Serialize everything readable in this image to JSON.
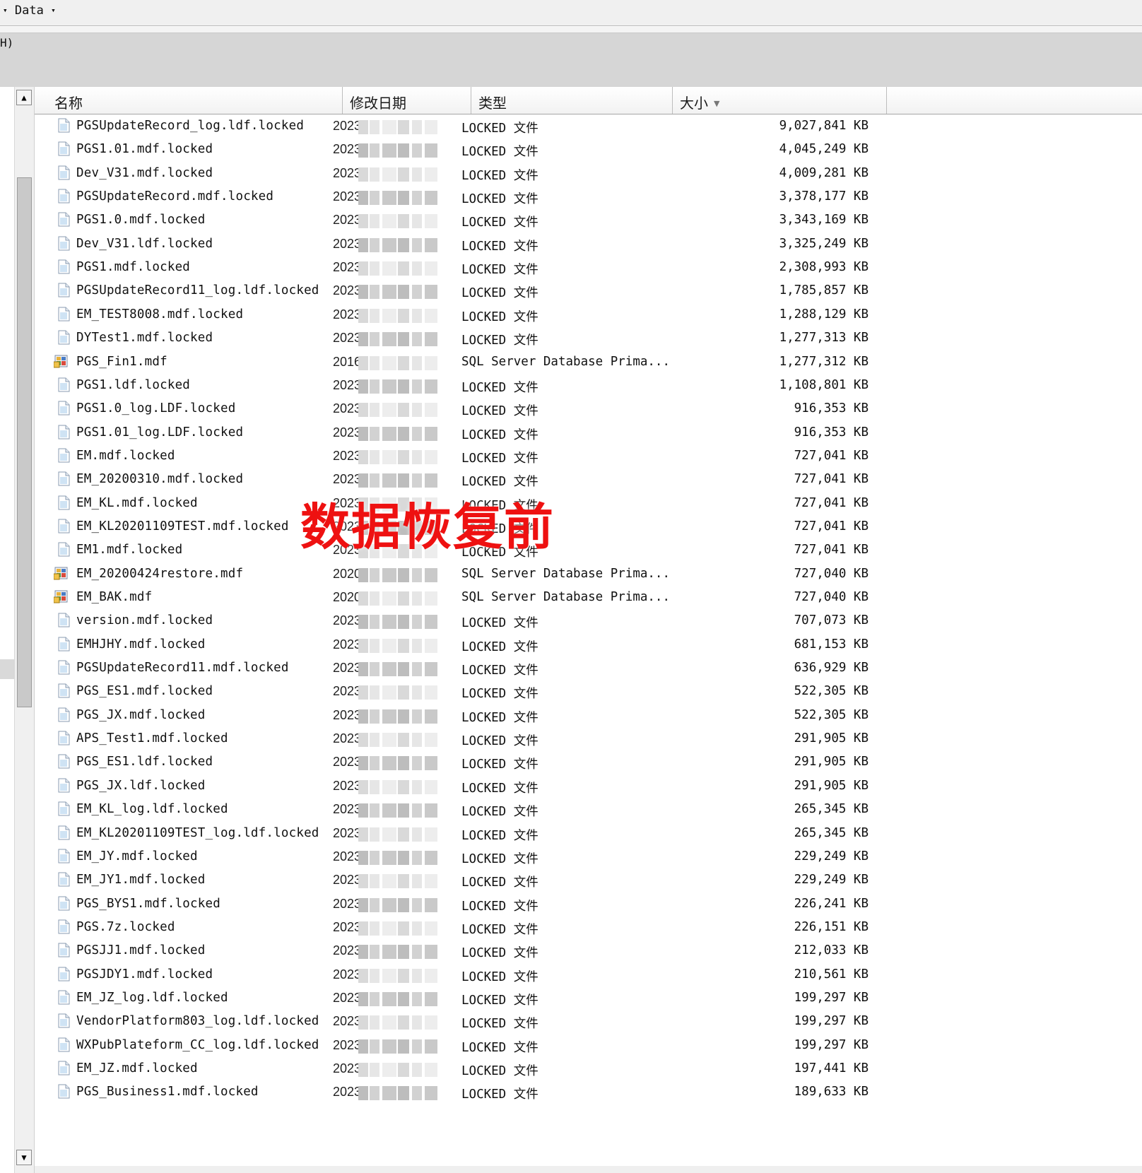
{
  "breadcrumb": {
    "label": "Data"
  },
  "toolbar": {
    "hotkey_fragment": "H)"
  },
  "columns": {
    "name": "名称",
    "date": "修改日期",
    "type": "类型",
    "size": "大小"
  },
  "watermark": "数据恢复前",
  "files": [
    {
      "name": "PGSUpdateRecord_log.ldf.locked",
      "date": "2023",
      "type": "LOCKED 文件",
      "size": "9,027,841 KB",
      "icon": "file-icon"
    },
    {
      "name": "PGS1.01.mdf.locked",
      "date": "2023",
      "type": "LOCKED 文件",
      "size": "4,045,249 KB",
      "icon": "file-icon"
    },
    {
      "name": "Dev_V31.mdf.locked",
      "date": "2023",
      "type": "LOCKED 文件",
      "size": "4,009,281 KB",
      "icon": "file-icon"
    },
    {
      "name": "PGSUpdateRecord.mdf.locked",
      "date": "2023",
      "type": "LOCKED 文件",
      "size": "3,378,177 KB",
      "icon": "file-icon"
    },
    {
      "name": "PGS1.0.mdf.locked",
      "date": "2023",
      "type": "LOCKED 文件",
      "size": "3,343,169 KB",
      "icon": "file-icon"
    },
    {
      "name": "Dev_V31.ldf.locked",
      "date": "2023",
      "type": "LOCKED 文件",
      "size": "3,325,249 KB",
      "icon": "file-icon"
    },
    {
      "name": "PGS1.mdf.locked",
      "date": "2023",
      "type": "LOCKED 文件",
      "size": "2,308,993 KB",
      "icon": "file-icon"
    },
    {
      "name": "PGSUpdateRecord11_log.ldf.locked",
      "date": "2023",
      "type": "LOCKED 文件",
      "size": "1,785,857 KB",
      "icon": "file-icon"
    },
    {
      "name": "EM_TEST8008.mdf.locked",
      "date": "2023",
      "type": "LOCKED 文件",
      "size": "1,288,129 KB",
      "icon": "file-icon"
    },
    {
      "name": "DYTest1.mdf.locked",
      "date": "2023",
      "type": "LOCKED 文件",
      "size": "1,277,313 KB",
      "icon": "file-icon"
    },
    {
      "name": "PGS_Fin1.mdf",
      "date": "2016",
      "type": "SQL Server Database Prima...",
      "size": "1,277,312 KB",
      "icon": "sql-database-icon"
    },
    {
      "name": "PGS1.ldf.locked",
      "date": "2023",
      "type": "LOCKED 文件",
      "size": "1,108,801 KB",
      "icon": "file-icon"
    },
    {
      "name": "PGS1.0_log.LDF.locked",
      "date": "2023",
      "type": "LOCKED 文件",
      "size": "916,353 KB",
      "icon": "file-icon"
    },
    {
      "name": "PGS1.01_log.LDF.locked",
      "date": "2023",
      "type": "LOCKED 文件",
      "size": "916,353 KB",
      "icon": "file-icon"
    },
    {
      "name": "EM.mdf.locked",
      "date": "2023",
      "type": "LOCKED 文件",
      "size": "727,041 KB",
      "icon": "file-icon"
    },
    {
      "name": "EM_20200310.mdf.locked",
      "date": "2023",
      "type": "LOCKED 文件",
      "size": "727,041 KB",
      "icon": "file-icon"
    },
    {
      "name": "EM_KL.mdf.locked",
      "date": "2023",
      "type": "LOCKED 文件",
      "size": "727,041 KB",
      "icon": "file-icon"
    },
    {
      "name": "EM_KL20201109TEST.mdf.locked",
      "date": "2023",
      "type": "LOCKED 文件",
      "size": "727,041 KB",
      "icon": "file-icon"
    },
    {
      "name": "EM1.mdf.locked",
      "date": "2023",
      "type": "LOCKED 文件",
      "size": "727,041 KB",
      "icon": "file-icon"
    },
    {
      "name": "EM_20200424restore.mdf",
      "date": "2020",
      "type": "SQL Server Database Prima...",
      "size": "727,040 KB",
      "icon": "sql-database-icon"
    },
    {
      "name": "EM_BAK.mdf",
      "date": "2020",
      "type": "SQL Server Database Prima...",
      "size": "727,040 KB",
      "icon": "sql-database-icon"
    },
    {
      "name": "version.mdf.locked",
      "date": "2023",
      "type": "LOCKED 文件",
      "size": "707,073 KB",
      "icon": "file-icon"
    },
    {
      "name": "EMHJHY.mdf.locked",
      "date": "2023",
      "type": "LOCKED 文件",
      "size": "681,153 KB",
      "icon": "file-icon"
    },
    {
      "name": "PGSUpdateRecord11.mdf.locked",
      "date": "2023",
      "type": "LOCKED 文件",
      "size": "636,929 KB",
      "icon": "file-icon"
    },
    {
      "name": "PGS_ES1.mdf.locked",
      "date": "2023",
      "type": "LOCKED 文件",
      "size": "522,305 KB",
      "icon": "file-icon"
    },
    {
      "name": "PGS_JX.mdf.locked",
      "date": "2023",
      "type": "LOCKED 文件",
      "size": "522,305 KB",
      "icon": "file-icon"
    },
    {
      "name": "APS_Test1.mdf.locked",
      "date": "2023",
      "type": "LOCKED 文件",
      "size": "291,905 KB",
      "icon": "file-icon"
    },
    {
      "name": "PGS_ES1.ldf.locked",
      "date": "2023",
      "type": "LOCKED 文件",
      "size": "291,905 KB",
      "icon": "file-icon"
    },
    {
      "name": "PGS_JX.ldf.locked",
      "date": "2023",
      "type": "LOCKED 文件",
      "size": "291,905 KB",
      "icon": "file-icon"
    },
    {
      "name": "EM_KL_log.ldf.locked",
      "date": "2023",
      "type": "LOCKED 文件",
      "size": "265,345 KB",
      "icon": "file-icon"
    },
    {
      "name": "EM_KL20201109TEST_log.ldf.locked",
      "date": "2023",
      "type": "LOCKED 文件",
      "size": "265,345 KB",
      "icon": "file-icon"
    },
    {
      "name": "EM_JY.mdf.locked",
      "date": "2023",
      "type": "LOCKED 文件",
      "size": "229,249 KB",
      "icon": "file-icon"
    },
    {
      "name": "EM_JY1.mdf.locked",
      "date": "2023",
      "type": "LOCKED 文件",
      "size": "229,249 KB",
      "icon": "file-icon"
    },
    {
      "name": "PGS_BYS1.mdf.locked",
      "date": "2023",
      "type": "LOCKED 文件",
      "size": "226,241 KB",
      "icon": "file-icon"
    },
    {
      "name": "PGS.7z.locked",
      "date": "2023",
      "type": "LOCKED 文件",
      "size": "226,151 KB",
      "icon": "file-icon"
    },
    {
      "name": "PGSJJ1.mdf.locked",
      "date": "2023",
      "type": "LOCKED 文件",
      "size": "212,033 KB",
      "icon": "file-icon"
    },
    {
      "name": "PGSJDY1.mdf.locked",
      "date": "2023",
      "type": "LOCKED 文件",
      "size": "210,561 KB",
      "icon": "file-icon"
    },
    {
      "name": "EM_JZ_log.ldf.locked",
      "date": "2023",
      "type": "LOCKED 文件",
      "size": "199,297 KB",
      "icon": "file-icon"
    },
    {
      "name": "VendorPlatform803_log.ldf.locked",
      "date": "2023",
      "type": "LOCKED 文件",
      "size": "199,297 KB",
      "icon": "file-icon"
    },
    {
      "name": "WXPubPlateform_CC_log.ldf.locked",
      "date": "2023",
      "type": "LOCKED 文件",
      "size": "199,297 KB",
      "icon": "file-icon"
    },
    {
      "name": "EM_JZ.mdf.locked",
      "date": "2023",
      "type": "LOCKED 文件",
      "size": "197,441 KB",
      "icon": "file-icon"
    },
    {
      "name": "PGS_Business1.mdf.locked",
      "date": "2023",
      "type": "LOCKED 文件",
      "size": "189,633 KB",
      "icon": "file-icon"
    }
  ]
}
